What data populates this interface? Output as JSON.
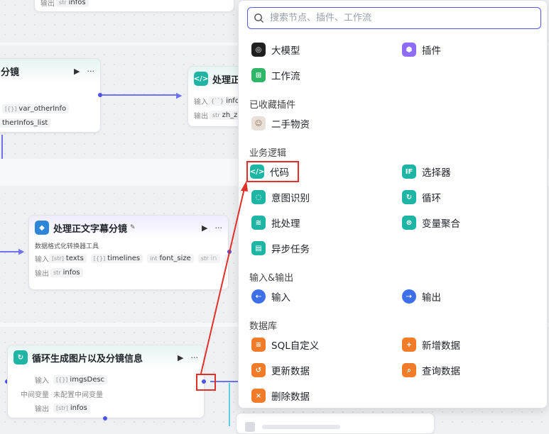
{
  "canvas": {
    "top_node": {
      "out_label": "输出",
      "out_tag_type": "str",
      "out_tag": "infos"
    },
    "left_node": {
      "title": "分镜",
      "tag_type": "[{}]",
      "tag1": "var_otherInfo",
      "tag2": "therInfos_list"
    },
    "mid_node": {
      "title": "处理正",
      "in_label": "输入",
      "in_tag_type": "{``}",
      "in_tag": "info",
      "out_label": "输出",
      "out_tag_type": "str",
      "out_tag": "zh_z"
    },
    "subtitle_node": {
      "title": "处理正文字幕分镜",
      "desc": "数据格式化转换器工具",
      "in_label": "输入",
      "in_tags": [
        {
          "type": "[str]",
          "name": "texts"
        },
        {
          "type": "[{}]",
          "name": "timelines"
        },
        {
          "type": "int",
          "name": "font_size"
        },
        {
          "type": "str",
          "name": "in"
        }
      ],
      "more": "···",
      "out_label": "输出",
      "out_tag_type": "str",
      "out_tag": "infos"
    },
    "loop_node": {
      "title": "循环生成图片以及分镜信息",
      "in_label": "输入",
      "in_tag_type": "[{}]",
      "in_tag": "imgsDesc",
      "mid_label": "中间变量",
      "mid_value": "未配置中间变量",
      "out_label": "输出",
      "out_tag_type": "[str]",
      "out_tag": "infos"
    }
  },
  "popup": {
    "search_placeholder": "搜索节点、插件、工作流",
    "top_items": [
      {
        "label": "大模型",
        "icon": "llm-icon"
      },
      {
        "label": "插件",
        "icon": "plugin-icon"
      },
      {
        "label": "工作流",
        "icon": "workflow-icon"
      }
    ],
    "sections": {
      "favorites": "已收藏插件",
      "business": "业务逻辑",
      "io": "输入&输出",
      "db": "数据库"
    },
    "favorite_items": [
      {
        "label": "二手物资",
        "icon": "avatar-icon"
      }
    ],
    "business_items": [
      {
        "label": "代码",
        "icon": "code-icon"
      },
      {
        "label": "选择器",
        "icon": "if-icon"
      },
      {
        "label": "意图识别",
        "icon": "intent-icon"
      },
      {
        "label": "循环",
        "icon": "loop-icon"
      },
      {
        "label": "批处理",
        "icon": "batch-icon"
      },
      {
        "label": "变量聚合",
        "icon": "aggregate-icon"
      },
      {
        "label": "异步任务",
        "icon": "async-icon"
      }
    ],
    "io_items": [
      {
        "label": "输入",
        "icon": "input-icon"
      },
      {
        "label": "输出",
        "icon": "output-icon"
      }
    ],
    "db_items": [
      {
        "label": "SQL自定义",
        "icon": "sql-icon"
      },
      {
        "label": "新增数据",
        "icon": "db-add-icon"
      },
      {
        "label": "更新数据",
        "icon": "db-update-icon"
      },
      {
        "label": "查询数据",
        "icon": "db-query-icon"
      },
      {
        "label": "删除数据",
        "icon": "db-delete-icon"
      }
    ]
  },
  "colors": {
    "accent": "#4d53e8",
    "annotation_red": "#e0302a",
    "teal": "#1fb5a5",
    "orange": "#f07c2a"
  }
}
